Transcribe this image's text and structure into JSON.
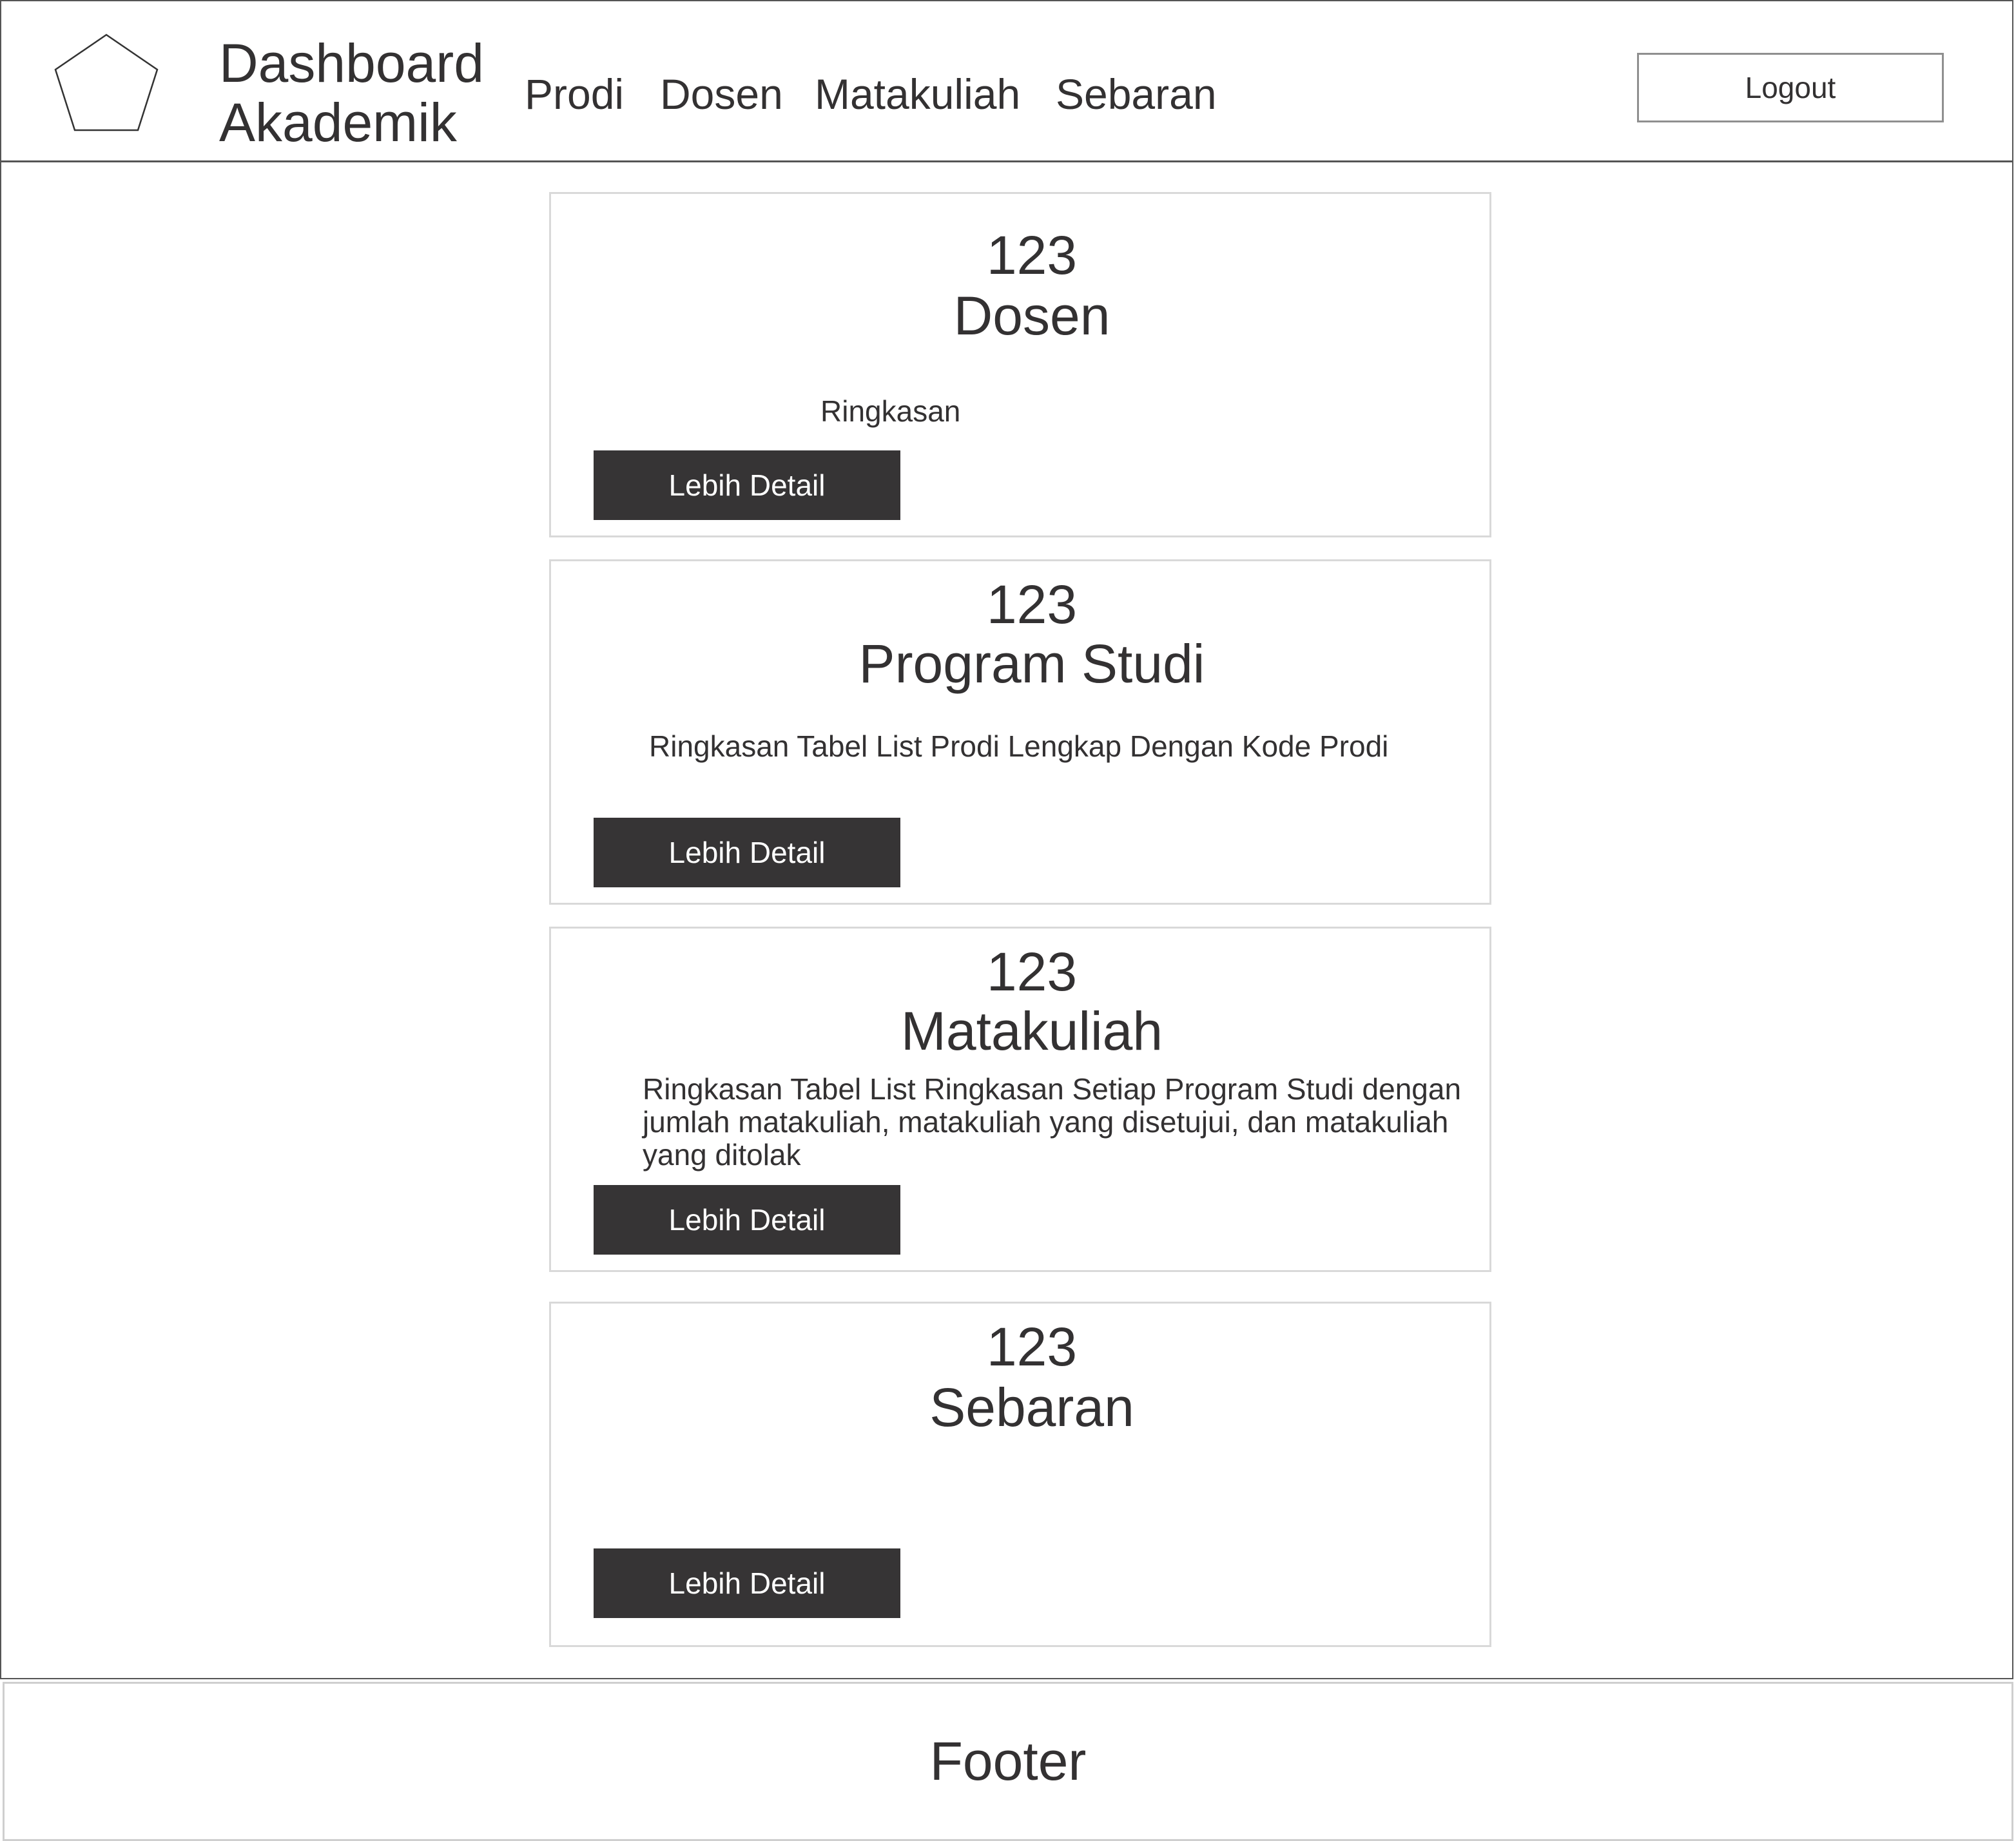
{
  "header": {
    "brand_line1": "Dashboard",
    "brand_line2": "Akademik",
    "logo_icon": "pentagon-logo-icon",
    "nav": [
      {
        "label": "Prodi"
      },
      {
        "label": "Dosen"
      },
      {
        "label": "Matakuliah"
      },
      {
        "label": "Sebaran"
      }
    ],
    "logout_label": "Logout"
  },
  "cards": [
    {
      "count": "123",
      "title": "Dosen",
      "summary": "Ringkasan",
      "button_label": "Lebih Detail"
    },
    {
      "count": "123",
      "title": "Program Studi",
      "summary": "Ringkasan Tabel List Prodi Lengkap Dengan Kode Prodi",
      "button_label": "Lebih Detail"
    },
    {
      "count": "123",
      "title": "Matakuliah",
      "summary_lines": [
        "Ringkasan Tabel List Ringkasan Setiap Program Studi dengan",
        "jumlah matakuliah, matakuliah yang disetujui, dan matakuliah",
        "yang ditolak"
      ],
      "button_label": "Lebih Detail"
    },
    {
      "count": "123",
      "title": "Sebaran",
      "summary": "",
      "button_label": "Lebih Detail"
    }
  ],
  "footer": {
    "label": "Footer"
  },
  "colors": {
    "button_dark": "#363435",
    "text": "#333132",
    "card_border": "#d9d9d9"
  }
}
